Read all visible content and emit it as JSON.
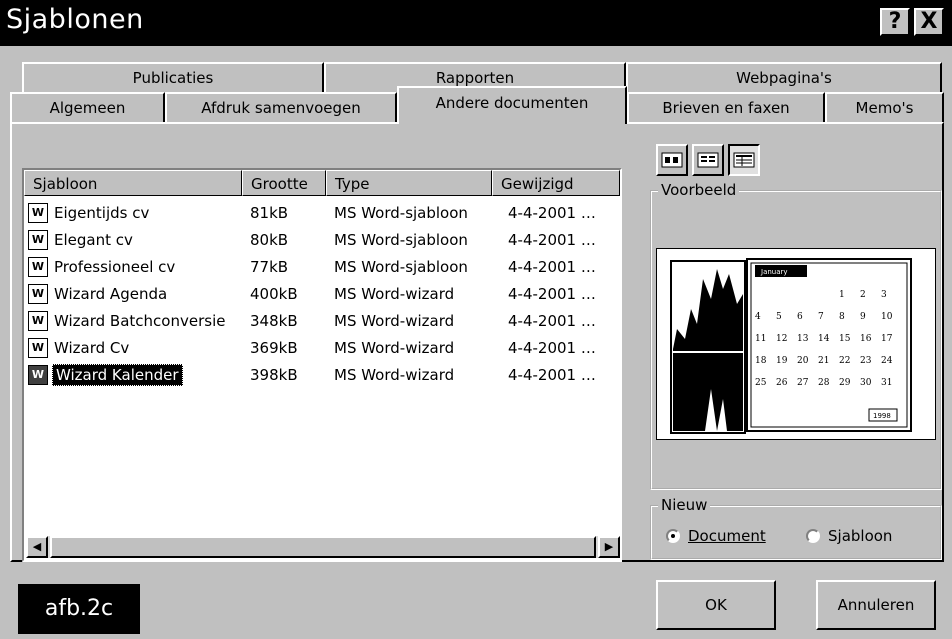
{
  "window": {
    "title": "Sjablonen",
    "help_glyph": "?",
    "close_glyph": "X"
  },
  "tabs_back": [
    "Publicaties",
    "Rapporten",
    "Webpagina's"
  ],
  "tabs_front": [
    "Algemeen",
    "Afdruk samenvoegen",
    "Andere documenten",
    "Brieven en faxen",
    "Memo's"
  ],
  "active_tab": "Andere documenten",
  "list": {
    "columns": [
      "Sjabloon",
      "Grootte",
      "Type",
      "Gewijzigd"
    ],
    "rows": [
      {
        "name": "Eigentijds cv",
        "size": "81kB",
        "type": "MS Word-sjabloon",
        "modified": "4-4-2001 …"
      },
      {
        "name": "Elegant cv",
        "size": "80kB",
        "type": "MS Word-sjabloon",
        "modified": "4-4-2001 …"
      },
      {
        "name": "Professioneel cv",
        "size": "77kB",
        "type": "MS Word-sjabloon",
        "modified": "4-4-2001 …"
      },
      {
        "name": "Wizard Agenda",
        "size": "400kB",
        "type": "MS Word-wizard",
        "modified": "4-4-2001 …"
      },
      {
        "name": "Wizard Batchconversie",
        "size": "348kB",
        "type": "MS Word-wizard",
        "modified": "4-4-2001 …"
      },
      {
        "name": "Wizard Cv",
        "size": "369kB",
        "type": "MS Word-wizard",
        "modified": "4-4-2001 …"
      },
      {
        "name": "Wizard Kalender",
        "size": "398kB",
        "type": "MS Word-wizard",
        "modified": "4-4-2001 …"
      }
    ],
    "selected": "Wizard Kalender",
    "scroll_left_glyph": "◀",
    "scroll_right_glyph": "▶"
  },
  "preview": {
    "label": "Voorbeeld",
    "month": "January",
    "year": "1998",
    "days": [
      "1",
      "2",
      "3",
      "4",
      "5",
      "6",
      "7",
      "8",
      "9",
      "10",
      "11",
      "12",
      "13",
      "14",
      "15",
      "16",
      "17",
      "18",
      "19",
      "20",
      "21",
      "22",
      "23",
      "24",
      "25",
      "26",
      "27",
      "28",
      "29",
      "30",
      "31"
    ]
  },
  "new_group": {
    "label": "Nieuw",
    "options": [
      "Document",
      "Sjabloon"
    ],
    "selected": "Document"
  },
  "buttons": {
    "ok": "OK",
    "cancel": "Annuleren"
  },
  "caption": "afb.2c"
}
